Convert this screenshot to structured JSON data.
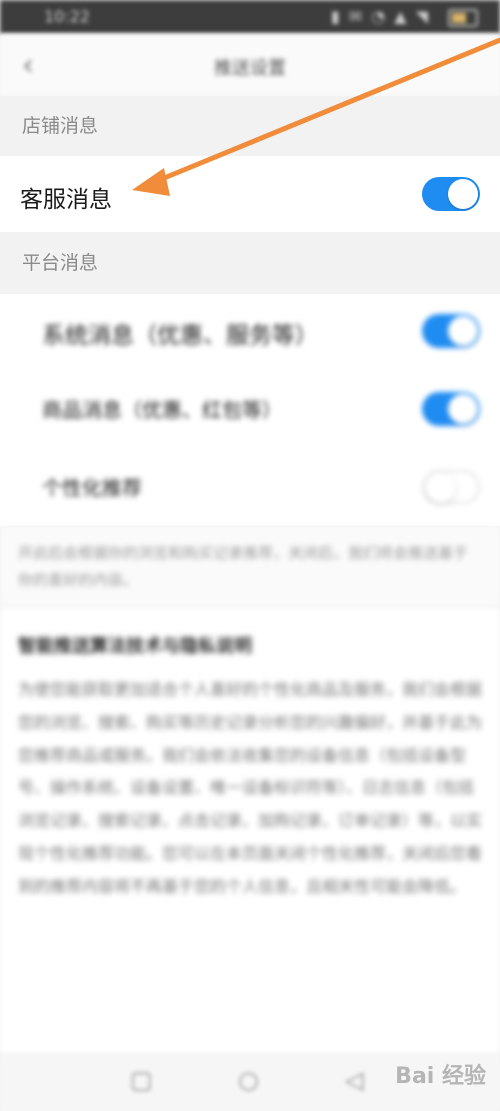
{
  "status_bar": {
    "time": "10:22",
    "indicators": "▮ ✉ ◔ ▲ ◥"
  },
  "header": {
    "title": "推送设置",
    "back_icon": "chevron-left-icon"
  },
  "sections": [
    {
      "header": "店铺消息",
      "items": [
        {
          "label": "客服消息",
          "toggle": "on"
        }
      ]
    },
    {
      "header": "平台消息",
      "items": [
        {
          "label": "系统消息（优惠、服务等）",
          "toggle": "on"
        },
        {
          "label": "商品消息（优惠、红包等）",
          "toggle": "on"
        },
        {
          "label": "个性化推荐",
          "toggle": "off"
        }
      ]
    }
  ],
  "note": "开启后会根据你的浏览和购买记录推荐，关闭后，我们将会推送基于你的喜好的内容。",
  "article": {
    "title": "智能推送算法技术与隐私说明",
    "body": "为使您能获取更加适合个人喜好的个性化商品及服务，我们会根据您的浏览、搜索、购买等历史记录分析您的兴趣偏好，并基于此为您推荐商品或服务。我们会依法收集您的设备信息（包括设备型号、操作系统、设备设置、唯一设备标识符等）、日志信息（包括浏览记录、搜索记录、点击记录、加购记录、订单记录）等，以实现个性化推荐功能。您可以在本页面关闭个性化推荐，关闭后您看到的推荐内容将不再基于您的个人信息，且相关性可能会降低。"
  },
  "nav": {
    "back_icon": "back-triangle-icon",
    "home_icon": "home-circle-icon",
    "recent_icon": "recent-square-icon"
  },
  "watermark": "Bai 经验",
  "colors": {
    "toggle_on": "#1f8cf2",
    "arrow": "#f08c3a"
  }
}
